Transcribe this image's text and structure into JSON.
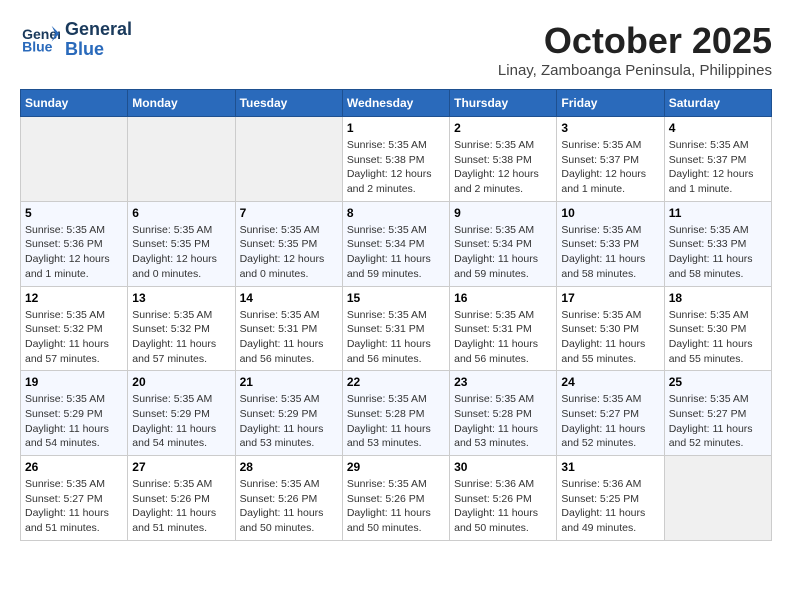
{
  "logo": {
    "line1": "General",
    "line2": "Blue"
  },
  "title": "October 2025",
  "location": "Linay, Zamboanga Peninsula, Philippines",
  "weekdays": [
    "Sunday",
    "Monday",
    "Tuesday",
    "Wednesday",
    "Thursday",
    "Friday",
    "Saturday"
  ],
  "weeks": [
    [
      {
        "day": "",
        "info": ""
      },
      {
        "day": "",
        "info": ""
      },
      {
        "day": "",
        "info": ""
      },
      {
        "day": "1",
        "info": "Sunrise: 5:35 AM\nSunset: 5:38 PM\nDaylight: 12 hours and 2 minutes."
      },
      {
        "day": "2",
        "info": "Sunrise: 5:35 AM\nSunset: 5:38 PM\nDaylight: 12 hours and 2 minutes."
      },
      {
        "day": "3",
        "info": "Sunrise: 5:35 AM\nSunset: 5:37 PM\nDaylight: 12 hours and 1 minute."
      },
      {
        "day": "4",
        "info": "Sunrise: 5:35 AM\nSunset: 5:37 PM\nDaylight: 12 hours and 1 minute."
      }
    ],
    [
      {
        "day": "5",
        "info": "Sunrise: 5:35 AM\nSunset: 5:36 PM\nDaylight: 12 hours and 1 minute."
      },
      {
        "day": "6",
        "info": "Sunrise: 5:35 AM\nSunset: 5:35 PM\nDaylight: 12 hours and 0 minutes."
      },
      {
        "day": "7",
        "info": "Sunrise: 5:35 AM\nSunset: 5:35 PM\nDaylight: 12 hours and 0 minutes."
      },
      {
        "day": "8",
        "info": "Sunrise: 5:35 AM\nSunset: 5:34 PM\nDaylight: 11 hours and 59 minutes."
      },
      {
        "day": "9",
        "info": "Sunrise: 5:35 AM\nSunset: 5:34 PM\nDaylight: 11 hours and 59 minutes."
      },
      {
        "day": "10",
        "info": "Sunrise: 5:35 AM\nSunset: 5:33 PM\nDaylight: 11 hours and 58 minutes."
      },
      {
        "day": "11",
        "info": "Sunrise: 5:35 AM\nSunset: 5:33 PM\nDaylight: 11 hours and 58 minutes."
      }
    ],
    [
      {
        "day": "12",
        "info": "Sunrise: 5:35 AM\nSunset: 5:32 PM\nDaylight: 11 hours and 57 minutes."
      },
      {
        "day": "13",
        "info": "Sunrise: 5:35 AM\nSunset: 5:32 PM\nDaylight: 11 hours and 57 minutes."
      },
      {
        "day": "14",
        "info": "Sunrise: 5:35 AM\nSunset: 5:31 PM\nDaylight: 11 hours and 56 minutes."
      },
      {
        "day": "15",
        "info": "Sunrise: 5:35 AM\nSunset: 5:31 PM\nDaylight: 11 hours and 56 minutes."
      },
      {
        "day": "16",
        "info": "Sunrise: 5:35 AM\nSunset: 5:31 PM\nDaylight: 11 hours and 56 minutes."
      },
      {
        "day": "17",
        "info": "Sunrise: 5:35 AM\nSunset: 5:30 PM\nDaylight: 11 hours and 55 minutes."
      },
      {
        "day": "18",
        "info": "Sunrise: 5:35 AM\nSunset: 5:30 PM\nDaylight: 11 hours and 55 minutes."
      }
    ],
    [
      {
        "day": "19",
        "info": "Sunrise: 5:35 AM\nSunset: 5:29 PM\nDaylight: 11 hours and 54 minutes."
      },
      {
        "day": "20",
        "info": "Sunrise: 5:35 AM\nSunset: 5:29 PM\nDaylight: 11 hours and 54 minutes."
      },
      {
        "day": "21",
        "info": "Sunrise: 5:35 AM\nSunset: 5:29 PM\nDaylight: 11 hours and 53 minutes."
      },
      {
        "day": "22",
        "info": "Sunrise: 5:35 AM\nSunset: 5:28 PM\nDaylight: 11 hours and 53 minutes."
      },
      {
        "day": "23",
        "info": "Sunrise: 5:35 AM\nSunset: 5:28 PM\nDaylight: 11 hours and 53 minutes."
      },
      {
        "day": "24",
        "info": "Sunrise: 5:35 AM\nSunset: 5:27 PM\nDaylight: 11 hours and 52 minutes."
      },
      {
        "day": "25",
        "info": "Sunrise: 5:35 AM\nSunset: 5:27 PM\nDaylight: 11 hours and 52 minutes."
      }
    ],
    [
      {
        "day": "26",
        "info": "Sunrise: 5:35 AM\nSunset: 5:27 PM\nDaylight: 11 hours and 51 minutes."
      },
      {
        "day": "27",
        "info": "Sunrise: 5:35 AM\nSunset: 5:26 PM\nDaylight: 11 hours and 51 minutes."
      },
      {
        "day": "28",
        "info": "Sunrise: 5:35 AM\nSunset: 5:26 PM\nDaylight: 11 hours and 50 minutes."
      },
      {
        "day": "29",
        "info": "Sunrise: 5:35 AM\nSunset: 5:26 PM\nDaylight: 11 hours and 50 minutes."
      },
      {
        "day": "30",
        "info": "Sunrise: 5:36 AM\nSunset: 5:26 PM\nDaylight: 11 hours and 50 minutes."
      },
      {
        "day": "31",
        "info": "Sunrise: 5:36 AM\nSunset: 5:25 PM\nDaylight: 11 hours and 49 minutes."
      },
      {
        "day": "",
        "info": ""
      }
    ]
  ]
}
